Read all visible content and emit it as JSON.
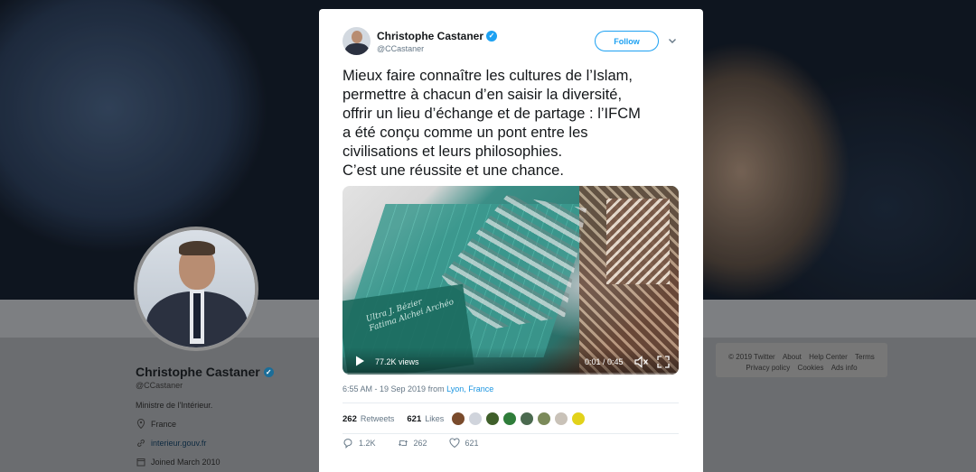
{
  "tweet": {
    "author_name": "Christophe Castaner",
    "author_handle": "@CCastaner",
    "follow_label": "Follow",
    "text_lines": [
      "Mieux faire connaître les cultures de l’Islam,",
      "permettre à chacun d’en saisir la diversité,",
      "offrir un lieu d’échange et de partage : l’IFCM",
      "a été conçu comme un pont entre les",
      "civilisations et leurs philosophies.",
      "C’est une réussite et une chance."
    ],
    "video": {
      "views": "77.2K views",
      "time": "0:01 / 0:45",
      "etched_text": "Ultra J. Bézier\nFatima Alchei Archéo"
    },
    "meta": {
      "timestamp": "6:55 AM - 19 Sep 2019 from ",
      "location": "Lyon, France"
    },
    "stats": {
      "retweets_count": "262",
      "retweets_label": "Retweets",
      "likes_count": "621",
      "likes_label": "Likes"
    },
    "actions": {
      "replies": "1.2K",
      "retweets": "262",
      "likes": "621"
    }
  },
  "profile": {
    "name": "Christophe Castaner",
    "handle": "@CCastaner",
    "bio": "Ministre de l'Intérieur.",
    "location": "France",
    "website": "interieur.gouv.fr",
    "joined": "Joined March 2010"
  },
  "footer": {
    "copyright": "© 2019 Twitter",
    "about": "About",
    "help": "Help Center",
    "terms": "Terms",
    "privacy": "Privacy policy",
    "cookies": "Cookies",
    "ads": "Ads info"
  },
  "icons": {
    "verified": "verified-badge-icon",
    "reply": "reply-icon",
    "retweet": "retweet-icon",
    "like": "heart-icon",
    "play": "play-icon",
    "mute": "mute-icon",
    "fullscreen": "fullscreen-icon"
  },
  "colors": {
    "accent": "#1da1f2",
    "link": "#1b95e0",
    "secondary_text": "#657786",
    "liker_avatars": [
      "#7a4b2c",
      "#d0d4dc",
      "#3f5f2a",
      "#2f7d3a",
      "#4b6a4f",
      "#7b8a5a",
      "#c9c2b8",
      "#e2d21a"
    ]
  }
}
